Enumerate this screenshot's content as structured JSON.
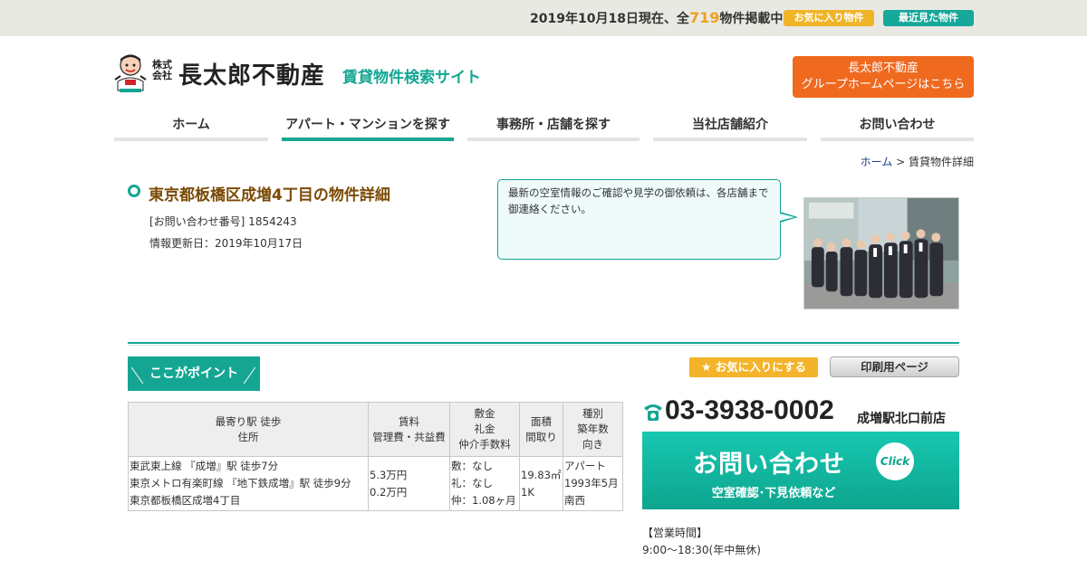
{
  "topbar": {
    "count_prefix": "2019年10月18日現在、全",
    "count_value": "719",
    "count_suffix": "物件掲載中",
    "favorites_label": "お気に入り物件",
    "recent_label": "最近見た物件"
  },
  "header": {
    "logo_kabu": "株式会社",
    "logo_name": "長太郎不動産",
    "site_subtitle": "賃貸物件検索サイト",
    "group_link_line1": "長太郎不動産",
    "group_link_line2": "グループホームページはこちら"
  },
  "nav": [
    {
      "label": "ホーム"
    },
    {
      "label": "アパート・マンションを探す"
    },
    {
      "label": "事務所・店舗を探す"
    },
    {
      "label": "当社店舗紹介"
    },
    {
      "label": "お問い合わせ"
    }
  ],
  "breadcrumb": {
    "home": "ホーム",
    "separator": " > ",
    "current": "賃貸物件詳細"
  },
  "property": {
    "title": "東京都板橋区成増4丁目の物件詳細",
    "inquiry_number": "[お問い合わせ番号] 1854243",
    "updated": "情報更新日：2019年10月17日"
  },
  "bubble_text": "最新の空室情報のご確認や見学の御依頼は、各店舗まで御連絡ください。",
  "point_badge": "ここがポイント",
  "favorite_button": "お気に入りにする",
  "print_button": "印刷用ページ",
  "table": {
    "headers": [
      [
        "最寄り駅 徒歩",
        "住所"
      ],
      [
        "賃料",
        "管理費・共益費"
      ],
      [
        "敷金",
        "礼金",
        "仲介手数料"
      ],
      [
        "面積",
        "間取り"
      ],
      [
        "種別",
        "築年数",
        "向き"
      ]
    ],
    "row": [
      [
        "東武東上線 『成増』駅 徒歩7分",
        "東京メトロ有楽町線 『地下鉄成増』駅 徒歩9分",
        "東京都板橋区成増4丁目"
      ],
      [
        "5.3万円",
        "0.2万円"
      ],
      [
        "敷：なし",
        "礼：なし",
        "仲：1.08ヶ月"
      ],
      [
        "19.83㎡",
        "1K"
      ],
      [
        "アパート",
        "1993年5月",
        "南西"
      ]
    ]
  },
  "contact": {
    "phone": "03-3938-0002",
    "store": "成増駅北口前店",
    "button_main": "お問い合わせ",
    "button_sub": "空室確認･下見依頼など",
    "click_label": "Click",
    "hours_label": "【営業時間】",
    "hours": "9:00～18:30(年中無休)"
  },
  "colors": {
    "brand_teal": "#14a693",
    "accent_orange": "#ef6a1f",
    "accent_yellow": "#f0b428",
    "title_brown": "#7a4a06"
  }
}
